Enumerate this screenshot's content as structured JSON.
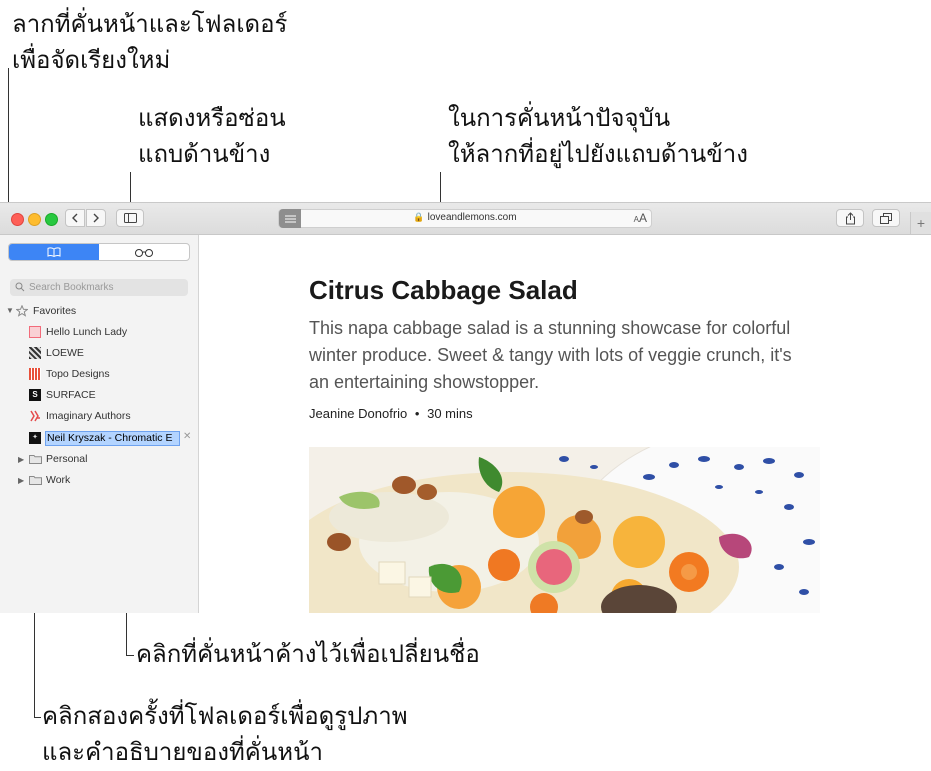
{
  "callouts": {
    "drag_reorder": [
      "ลากที่คั่นหน้าและโฟลเดอร์",
      "เพื่อจัดเรียงใหม่"
    ],
    "show_hide_sidebar": [
      "แสดงหรือซ่อน",
      "แถบด้านข้าง"
    ],
    "drag_current_page": [
      "ในการคั่นหน้าปัจจุบัน",
      "ให้ลากที่อยู่ไปยังแถบด้านข้าง"
    ],
    "click_to_rename": [
      "คลิกที่คั่นหน้าค้างไว้เพื่อเปลี่ยนชื่อ"
    ],
    "double_click_folder": [
      "คลิกสองครั้งที่โฟลเดอร์เพื่อดูรูปภาพ",
      "และคำอธิบายของที่คั่นหน้า"
    ]
  },
  "toolbar": {
    "address": "loveandlemons.com",
    "aa_label_small": "A",
    "aa_label": "A",
    "new_tab": "+"
  },
  "sidebar": {
    "search_placeholder": "Search Bookmarks",
    "favorites_label": "Favorites",
    "bookmarks": [
      {
        "label": "Hello Lunch Lady",
        "favicon_color": "#f26b7a"
      },
      {
        "label": "LOEWE",
        "favicon_color": "#333333"
      },
      {
        "label": "Topo Designs",
        "favicon_color": "#e8503a"
      },
      {
        "label": "SURFACE",
        "favicon_color": "#111111",
        "favicon_letter": "S"
      },
      {
        "label": "Imaginary Authors",
        "favicon_color": "#e44b4b"
      }
    ],
    "editing_bookmark": "Neil Kryszak - Chromatic E",
    "folders": [
      {
        "label": "Personal"
      },
      {
        "label": "Work"
      }
    ]
  },
  "article": {
    "title": "Citrus Cabbage Salad",
    "dek": "This napa cabbage salad is a stunning showcase for colorful winter produce. Sweet & tangy with lots of veggie crunch, it's an entertaining showstopper.",
    "author": "Jeanine Donofrio",
    "separator": "•",
    "time": "30 mins"
  },
  "colors": {
    "accent": "#3d85f5",
    "selection": "#b3d4ff"
  }
}
